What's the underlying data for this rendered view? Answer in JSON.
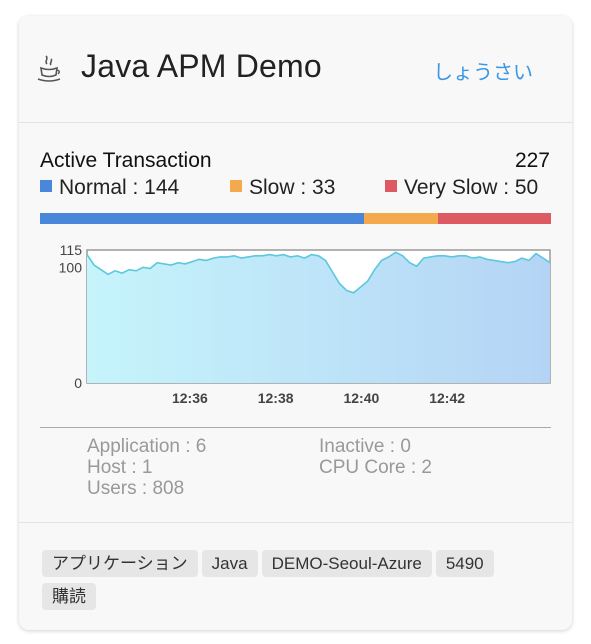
{
  "header": {
    "title": "Java APM Demo",
    "detail_link": "しょうさい",
    "icon": "java-icon"
  },
  "active": {
    "label": "Active Transaction",
    "total": "227",
    "legend": [
      {
        "label": "Normal : 144",
        "color": "#4a86d9"
      },
      {
        "label": "Slow : 33",
        "color": "#f5a94e"
      },
      {
        "label": "Very Slow : 50",
        "color": "#de5a63"
      }
    ]
  },
  "chart_data": {
    "type": "area",
    "title": "",
    "xlabel": "",
    "ylabel": "",
    "ylim": [
      0,
      115
    ],
    "y_ticks": [
      "0",
      "100",
      "115"
    ],
    "x_ticks": [
      "12:36",
      "12:38",
      "12:40",
      "12:42"
    ],
    "x_tick_positions": [
      2.4,
      4.4,
      6.4,
      8.4
    ],
    "x_range": [
      0,
      10.8
    ],
    "grid": false,
    "series": [
      {
        "values": [
          111,
          102,
          98,
          94,
          97,
          95,
          98,
          97,
          100,
          99,
          104,
          103,
          102,
          104,
          103,
          105,
          107,
          106,
          108,
          109,
          109,
          110,
          108,
          109,
          110,
          110,
          111,
          110,
          111,
          109,
          110,
          108,
          111,
          110,
          106,
          96,
          86,
          80,
          78,
          83,
          88,
          98,
          106,
          109,
          113,
          110,
          104,
          101,
          108,
          109,
          110,
          110,
          109,
          110,
          110,
          108,
          109,
          107,
          106,
          105,
          104,
          105,
          108,
          106,
          112,
          108,
          104
        ]
      }
    ]
  },
  "info": {
    "application": "Application : 6",
    "inactive": "Inactive : 0",
    "host": "Host : 1",
    "cpu_core": "CPU Core : 2",
    "users": "Users : 808"
  },
  "tags": [
    "アプリケーション",
    "Java",
    "DEMO-Seoul-Azure",
    "5490",
    "購読"
  ]
}
